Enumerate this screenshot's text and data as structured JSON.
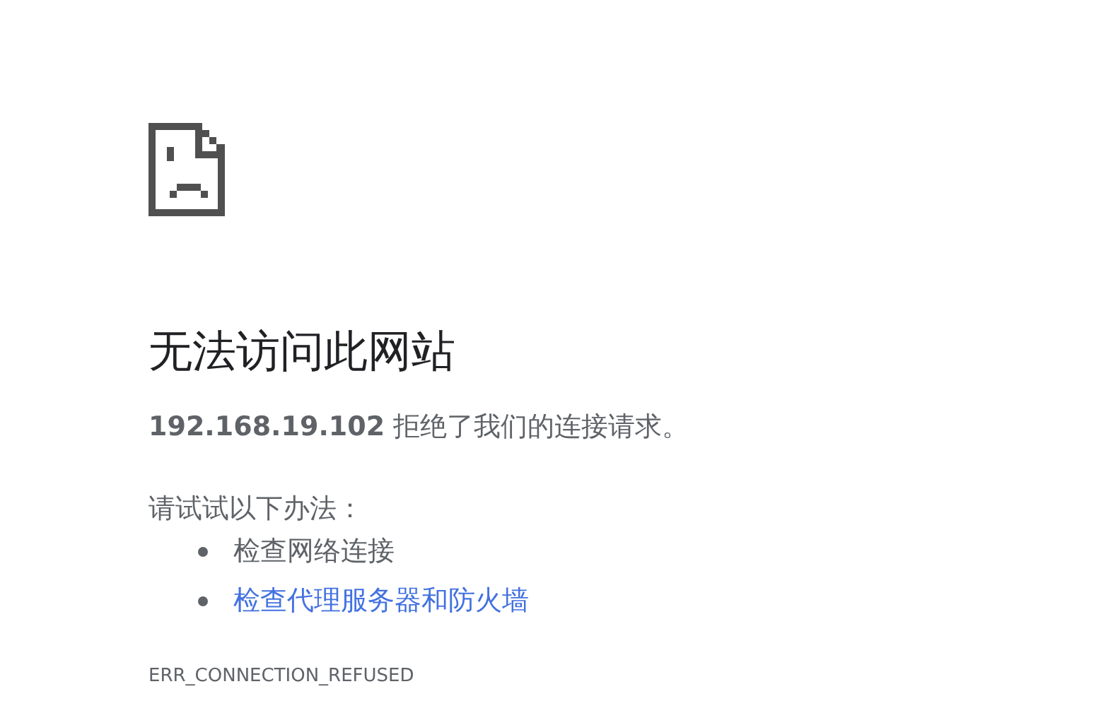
{
  "heading": "无法访问此网站",
  "message": "**192.168.19.102** 拒绝了我们的连接请求。",
  "suggestions_intro": "请试试以下办法：",
  "suggestions": [
    {
      "text": "检查网络连接",
      "kind": "text"
    },
    {
      "text": "检查代理服务器和防火墙",
      "kind": "link"
    }
  ],
  "error_code": "ERR_CONNECTION_REFUSED"
}
